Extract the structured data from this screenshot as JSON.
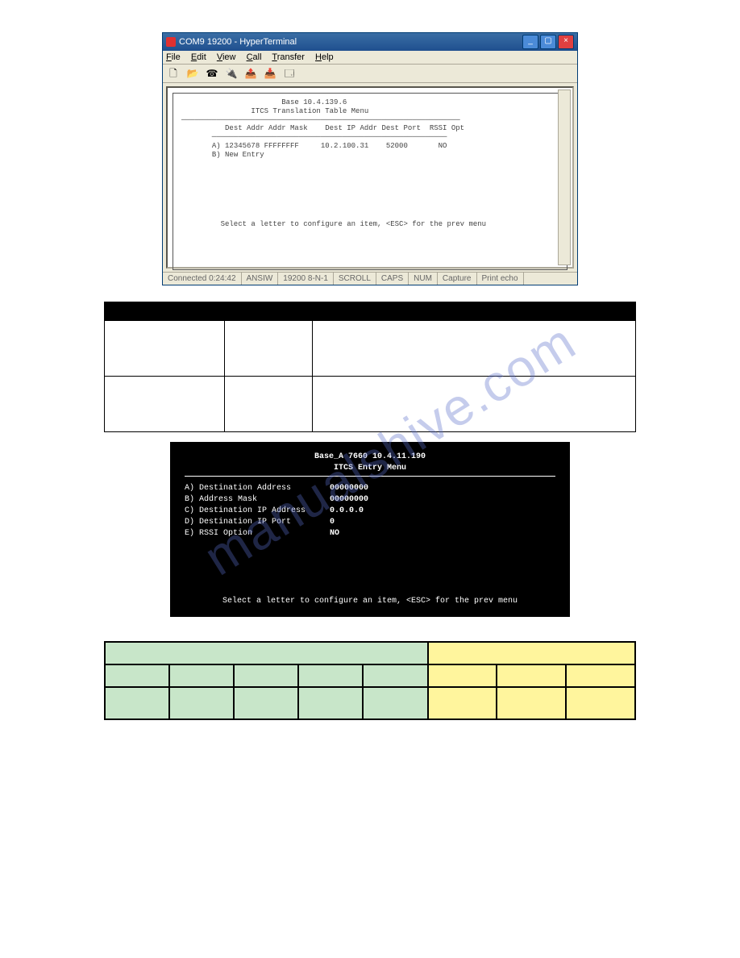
{
  "window": {
    "title": "COM9 19200 - HyperTerminal",
    "menus": {
      "file": "File",
      "edit": "Edit",
      "view": "View",
      "call": "Call",
      "transfer": "Transfer",
      "help": "Help"
    },
    "terminal": {
      "header1": "Base 10.4.139.6",
      "header2": "ITCS Translation Table Menu",
      "cols": "Dest Addr Addr Mask    Dest IP Addr Dest Port  RSSI Opt",
      "rowA": "A) 12345678 FFFFFFFF     10.2.100.31    52000       NO",
      "rowB": "B) New Entry",
      "footer": "Select a letter to configure an item, <ESC> for the prev menu"
    },
    "status": {
      "conn": "Connected 0:24:42",
      "emul": "ANSIW",
      "baud": "19200 8-N-1",
      "scroll": "SCROLL",
      "caps": "CAPS",
      "num": "NUM",
      "capture": "Capture",
      "echo": "Print echo"
    }
  },
  "console": {
    "header1": "Base_A 7660 10.4.11.190",
    "header2": "ITCS Entry Menu",
    "items": [
      {
        "label": "A) Destination Address",
        "value": "00000000"
      },
      {
        "label": "B) Address Mask",
        "value": "00000000"
      },
      {
        "label": "C) Destination IP Address",
        "value": "0.0.0.0"
      },
      {
        "label": "D) Destination IP Port",
        "value": "0"
      },
      {
        "label": "E) RSSI Option",
        "value": "NO"
      }
    ],
    "footer": "Select a letter to configure an item, <ESC> for the prev menu"
  },
  "watermark": "manualshive.com"
}
